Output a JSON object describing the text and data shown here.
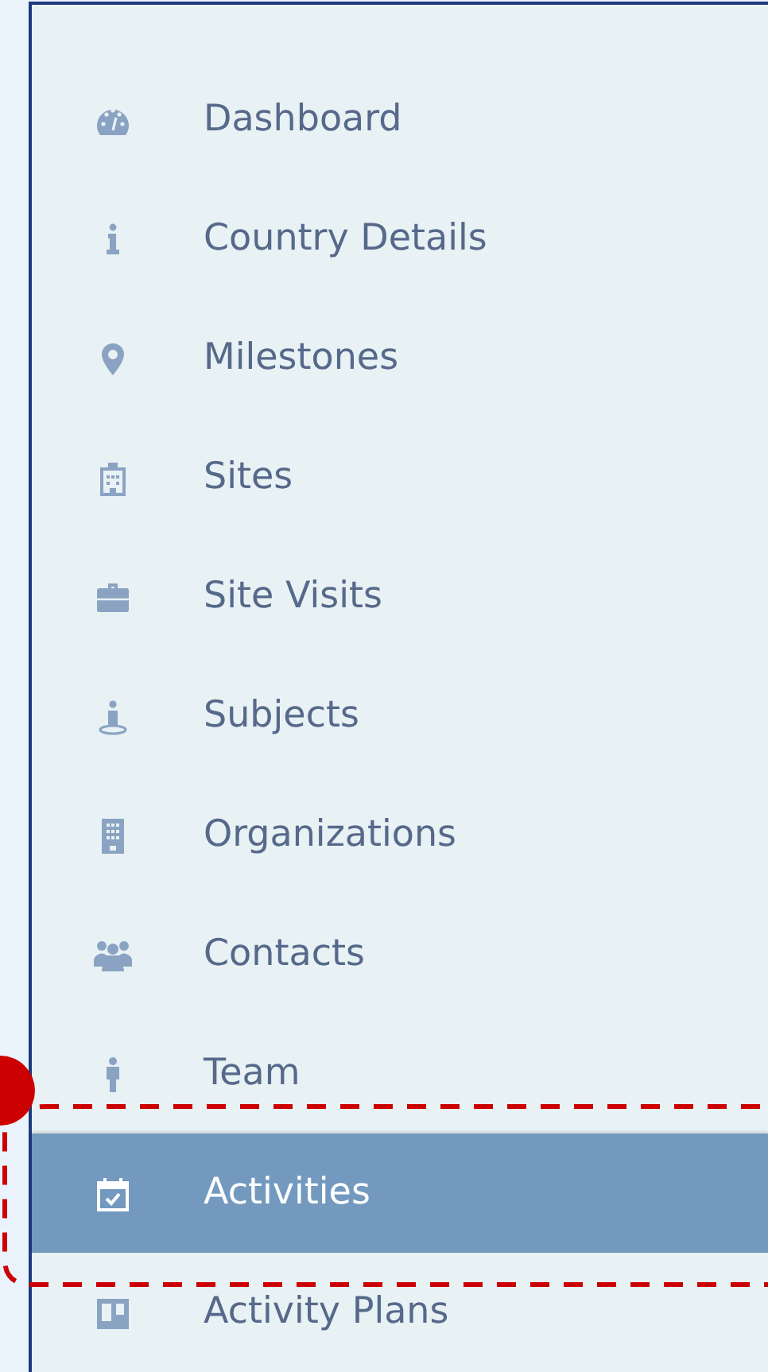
{
  "sidebar": {
    "items": [
      {
        "label": "Dashboard",
        "selected": false
      },
      {
        "label": "Country Details",
        "selected": false
      },
      {
        "label": "Milestones",
        "selected": false
      },
      {
        "label": "Sites",
        "selected": false
      },
      {
        "label": "Site Visits",
        "selected": false
      },
      {
        "label": "Subjects",
        "selected": false
      },
      {
        "label": "Organizations",
        "selected": false
      },
      {
        "label": "Contacts",
        "selected": false
      },
      {
        "label": "Team",
        "selected": false
      },
      {
        "label": "Activities",
        "selected": true
      },
      {
        "label": "Activity Plans",
        "selected": false
      }
    ]
  }
}
